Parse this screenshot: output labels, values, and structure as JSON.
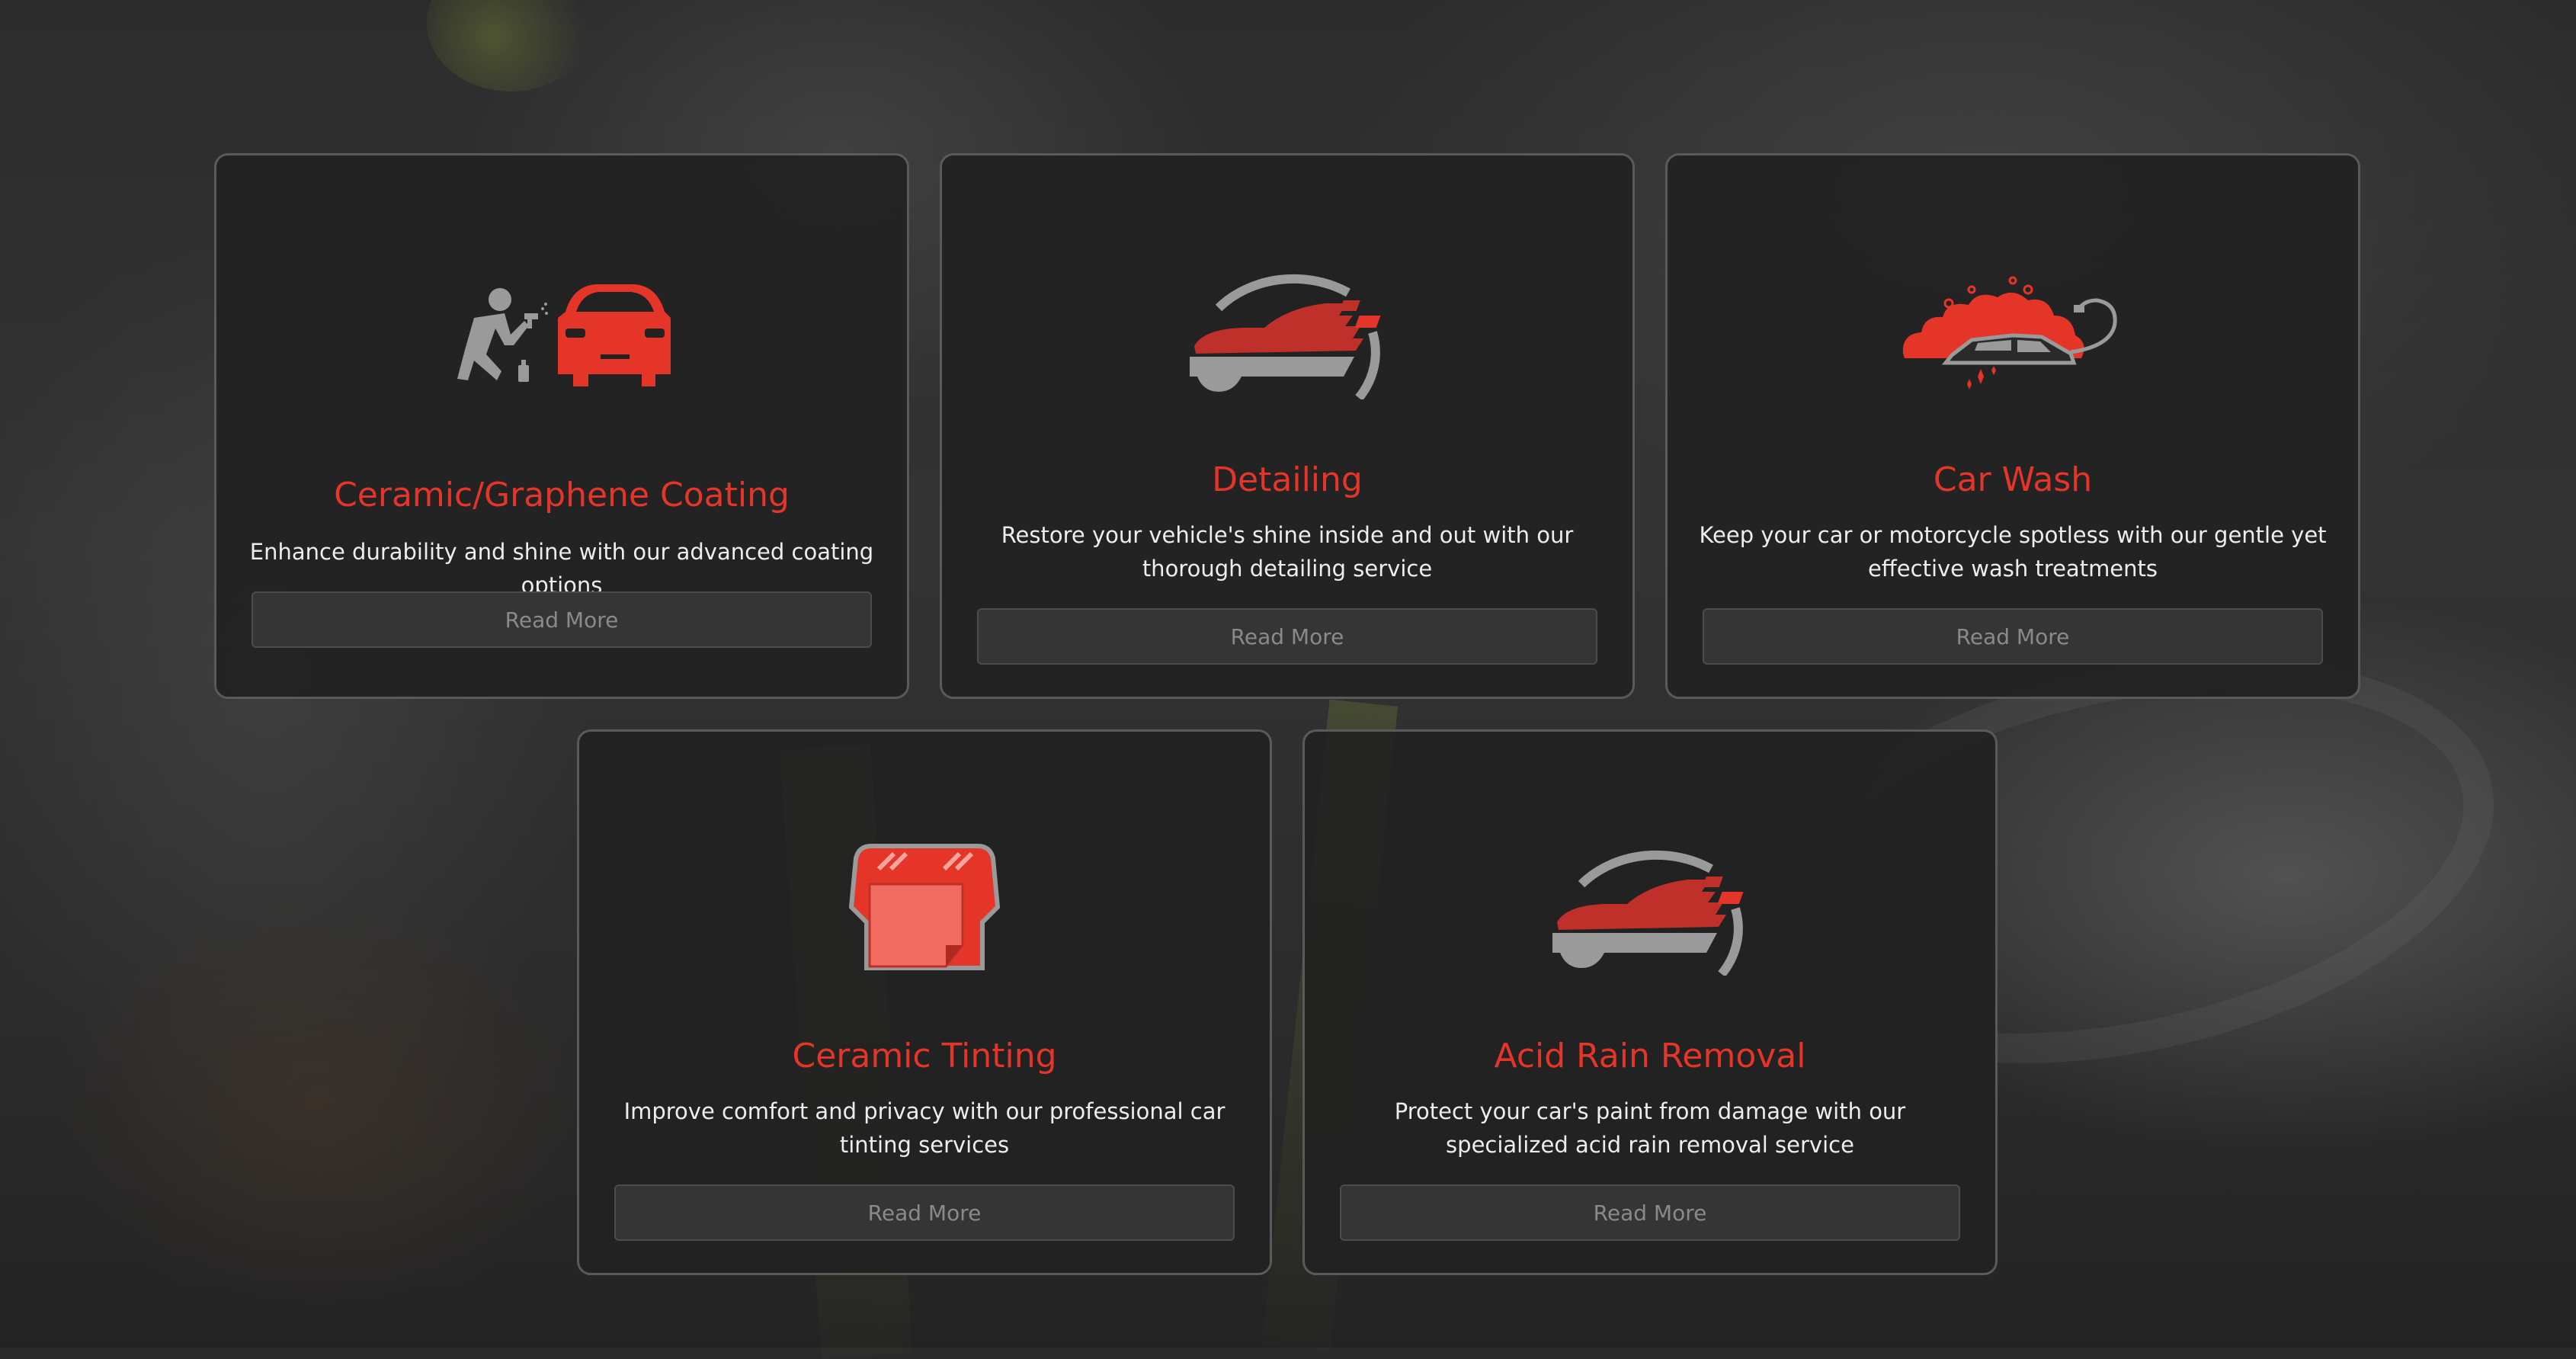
{
  "colors": {
    "accent": "#e53529",
    "card_bg": "#222222",
    "card_border": "#5a5a5a",
    "button_bg": "#353535",
    "button_text": "#8a8a8a",
    "body_text": "#ededed"
  },
  "services": [
    {
      "icon": "person-spraying-car-icon",
      "title": "Ceramic/Graphene Coating",
      "description": "Enhance durability and shine with our advanced coating options",
      "button": "Read More"
    },
    {
      "icon": "speeding-car-detailing-icon",
      "title": "Detailing",
      "description": "Restore your vehicle's shine inside and out with our thorough detailing service",
      "button": "Read More"
    },
    {
      "icon": "car-wash-foam-icon",
      "title": "Car Wash",
      "description": "Keep your car or motorcycle spotless with our gentle yet effective wash treatments",
      "button": "Read More"
    },
    {
      "icon": "window-tint-film-icon",
      "title": "Ceramic Tinting",
      "description": "Improve comfort and privacy with our professional car tinting services",
      "button": "Read More"
    },
    {
      "icon": "speeding-car-acid-rain-icon",
      "title": "Acid Rain Removal",
      "description": "Protect your car's paint from damage with our specialized acid rain removal service",
      "button": "Read More"
    }
  ]
}
